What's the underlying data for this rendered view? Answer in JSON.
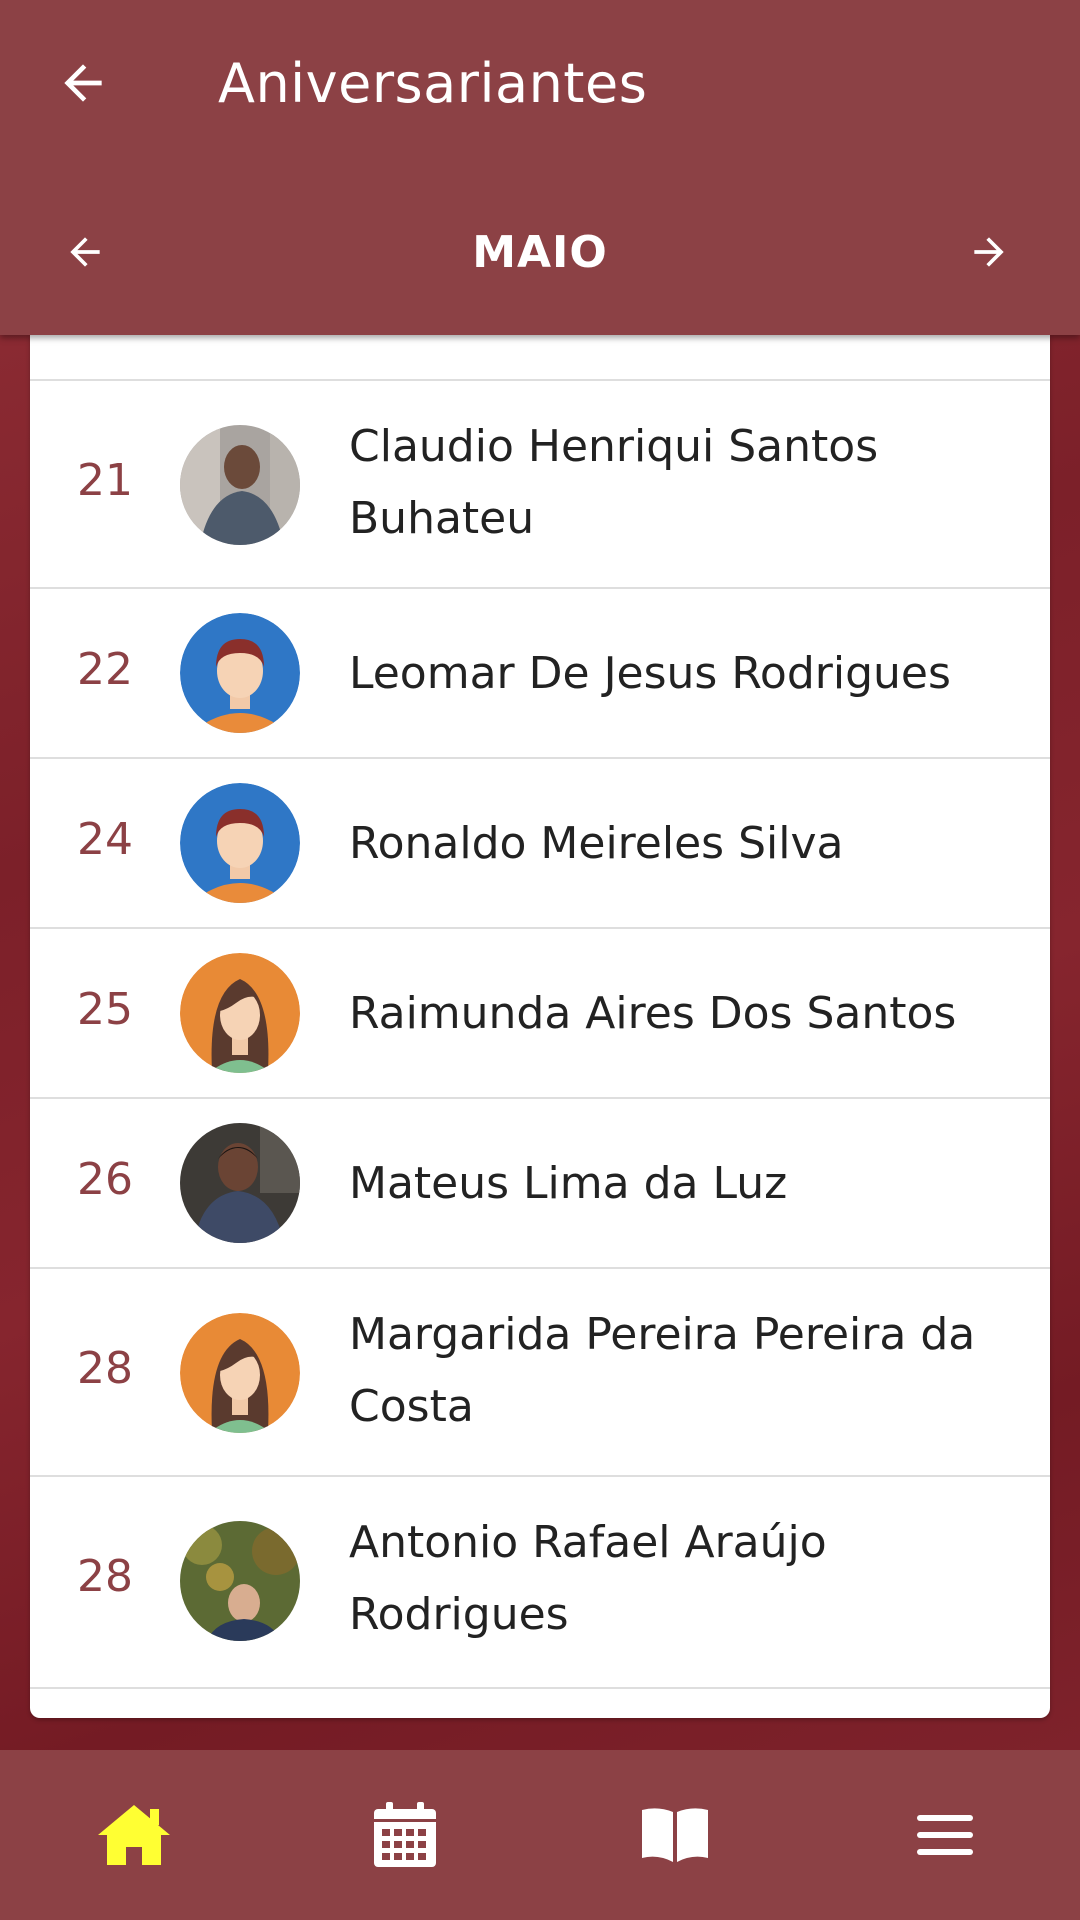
{
  "header": {
    "title": "Aniversariantes",
    "month": "MAIO"
  },
  "colors": {
    "brand": "#8c4145",
    "background": "#7a1e26",
    "active_nav": "#ffff33",
    "day_text": "#8c4145"
  },
  "birthdays": [
    {
      "day": "21",
      "name_line1": "Claudio Henriqui Santos",
      "name_line2": "Buhateu",
      "avatar": "photo-avatar-icon"
    },
    {
      "day": "22",
      "name_line1": "Leomar De Jesus Rodrigues",
      "name_line2": "",
      "avatar": "male-avatar-icon"
    },
    {
      "day": "24",
      "name_line1": "Ronaldo Meireles Silva",
      "name_line2": "",
      "avatar": "male-avatar-icon"
    },
    {
      "day": "25",
      "name_line1": "Raimunda Aires Dos Santos",
      "name_line2": "",
      "avatar": "female-avatar-icon"
    },
    {
      "day": "26",
      "name_line1": "Mateus Lima da Luz",
      "name_line2": "",
      "avatar": "photo-avatar-icon"
    },
    {
      "day": "28",
      "name_line1": "Margarida Pereira Pereira da",
      "name_line2": "Costa",
      "avatar": "female-avatar-icon"
    },
    {
      "day": "28",
      "name_line1": "Antonio Rafael Araújo",
      "name_line2": "Rodrigues",
      "avatar": "photo-avatar-icon"
    }
  ],
  "nav": {
    "items": [
      "home-icon",
      "calendar-icon",
      "book-icon",
      "menu-icon"
    ],
    "active": "home-icon"
  }
}
